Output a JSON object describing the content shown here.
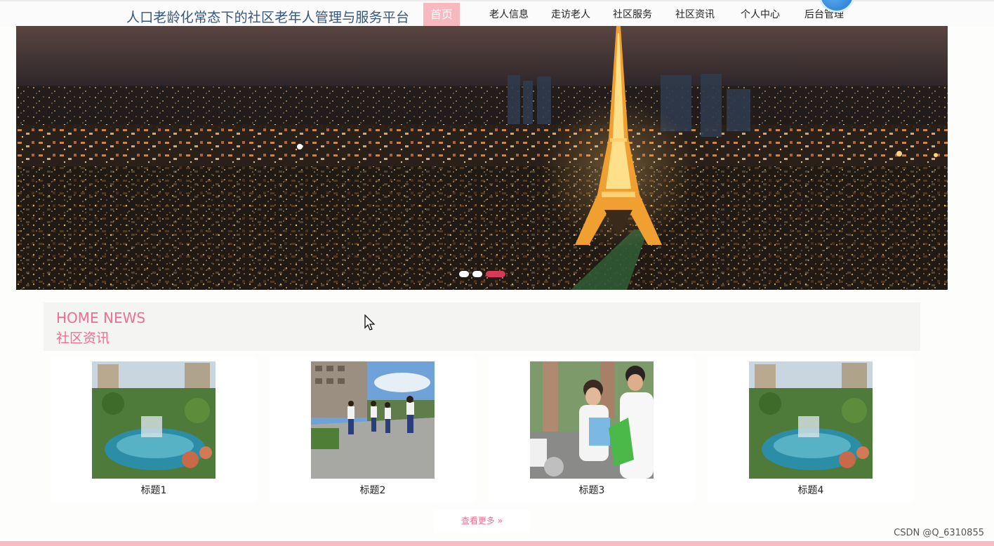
{
  "site": {
    "title": "人口老龄化常态下的社区老年人管理与服务平台"
  },
  "nav": {
    "items": [
      {
        "label": "首页",
        "active": true
      },
      {
        "label": "老人信息"
      },
      {
        "label": "走访老人"
      },
      {
        "label": "社区服务"
      },
      {
        "label": "社区资讯"
      },
      {
        "label": "个人中心"
      },
      {
        "label": "后台管理"
      }
    ]
  },
  "carousel": {
    "slide_count": 3,
    "active_index": 2,
    "accent": "#d63a58"
  },
  "news": {
    "heading_en": "HOME NEWS",
    "heading_cn": "社区资讯",
    "items": [
      {
        "title": "标题1",
        "image": "garden-pond-photo"
      },
      {
        "title": "标题2",
        "image": "walking-seniors-photo"
      },
      {
        "title": "标题3",
        "image": "community-volunteers-photo"
      },
      {
        "title": "标题4",
        "image": "garden-pond-photo"
      }
    ],
    "more_label": "查看更多 »"
  },
  "watermark": "CSDN @Q_6310855",
  "colors": {
    "primary_pink": "#ef6f93",
    "nav_active_bg": "#f7b8be",
    "title_blue": "#36567d",
    "bottom_bar": "#f7bcc4"
  }
}
